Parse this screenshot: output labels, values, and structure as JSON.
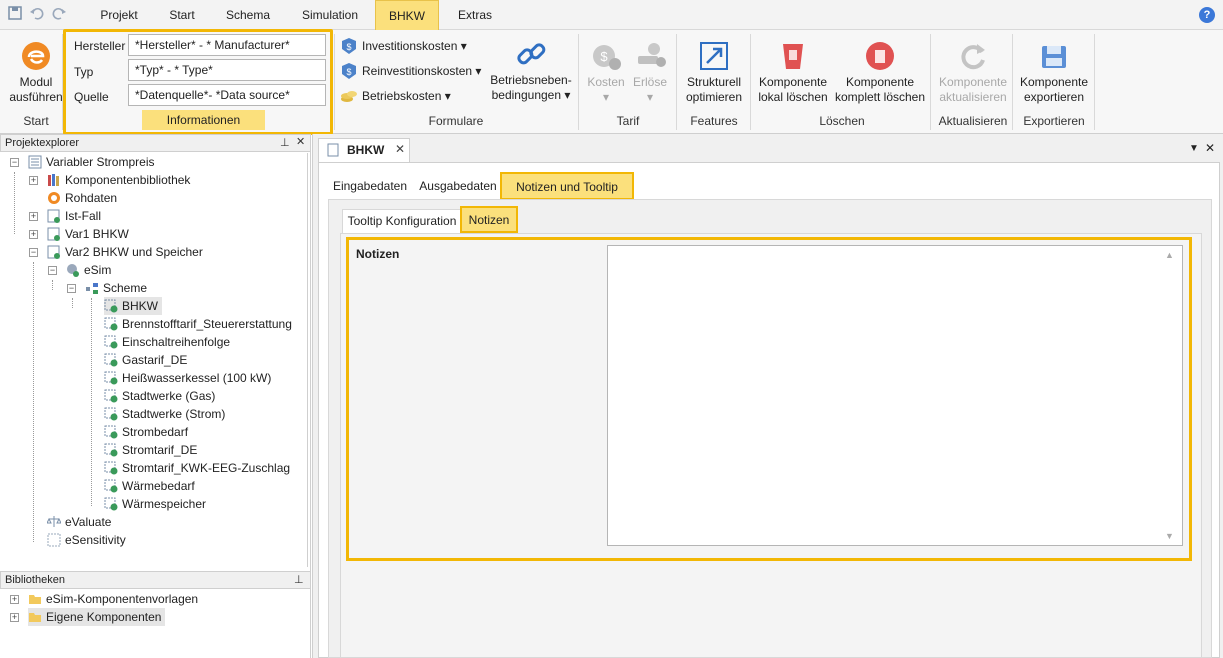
{
  "menubar": {
    "tabs": [
      "Projekt",
      "Start",
      "Schema",
      "Simulation",
      "BHKW",
      "Extras"
    ],
    "active_tab": "BHKW",
    "help_label": "?"
  },
  "ribbon": {
    "start": {
      "modul_label_line1": "Modul",
      "modul_label_line2": "ausführen",
      "group_label": "Start"
    },
    "info": {
      "hersteller_label": "Hersteller",
      "hersteller_value": "*Hersteller* - * Manufacturer*",
      "typ_label": "Typ",
      "typ_value": "*Typ* - * Type*",
      "quelle_label": "Quelle",
      "quelle_value": "*Datenquelle*- *Data source*",
      "group_label": "Informationen"
    },
    "formulare": {
      "invest": "Investitionskosten",
      "reinvest": "Reinvestitionskosten",
      "betrieb": "Betriebskosten",
      "nebenbed_line1": "Betriebsneben-",
      "nebenbed_line2": "bedingungen",
      "group_label": "Formulare"
    },
    "tarif": {
      "kosten": "Kosten",
      "erloese": "Erlöse",
      "group_label": "Tarif"
    },
    "features": {
      "line1": "Strukturell",
      "line2": "optimieren",
      "group_label": "Features"
    },
    "loeschen": {
      "lokal_line1": "Komponente",
      "lokal_line2": "lokal löschen",
      "komplett_line1": "Komponente",
      "komplett_line2": "komplett löschen",
      "group_label": "Löschen"
    },
    "aktualisieren": {
      "line1": "Komponente",
      "line2": "aktualisieren",
      "group_label": "Aktualisieren"
    },
    "exportieren": {
      "line1": "Komponente",
      "line2": "exportieren",
      "group_label": "Exportieren"
    }
  },
  "project_explorer": {
    "title": "Projektexplorer",
    "items": [
      "Variabler Strompreis",
      "Komponentenbibliothek",
      "Rohdaten",
      "Ist-Fall",
      "Var1 BHKW",
      "Var2 BHKW und Speicher",
      "eSim",
      "Scheme",
      "BHKW",
      "Brennstofftarif_Steuererstattung",
      "Einschaltreihenfolge",
      "Gastarif_DE",
      "Heißwasserkessel (100 kW)",
      "Stadtwerke (Gas)",
      "Stadtwerke (Strom)",
      "Strombedarf",
      "Stromtarif_DE",
      "Stromtarif_KWK-EEG-Zuschlag",
      "Wärmebedarf",
      "Wärmespeicher",
      "eValuate",
      "eSensitivity"
    ]
  },
  "libraries": {
    "title": "Bibliotheken",
    "items": [
      "eSim-Komponentenvorlagen",
      "Eigene Komponenten"
    ]
  },
  "document": {
    "tab_title": "BHKW",
    "tabs": [
      "Eingabedaten",
      "Ausgabedaten",
      "Notizen und Tooltip"
    ],
    "subtabs": [
      "Tooltip Konfiguration",
      "Notizen"
    ],
    "notes_label": "Notizen",
    "notes_value": ""
  },
  "colors": {
    "highlight": "#f2b705",
    "active_tab": "#fbe07c",
    "delete_red": "#e05252",
    "link_blue": "#2f6fc2"
  }
}
